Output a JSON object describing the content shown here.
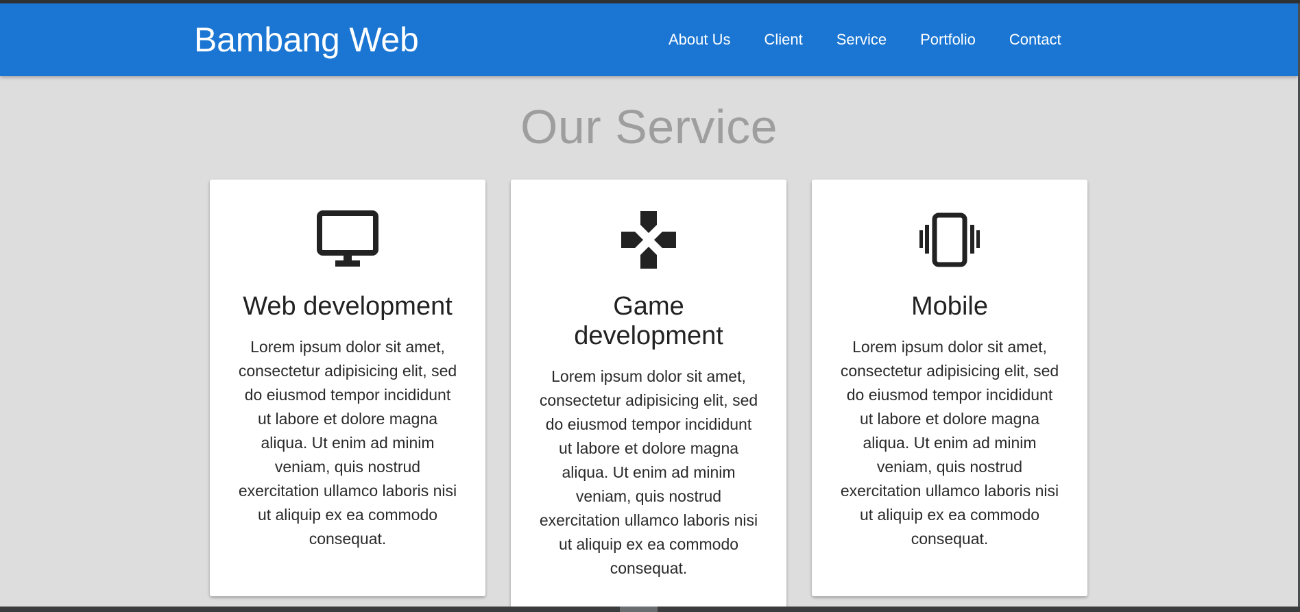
{
  "brand": "Bambang Web",
  "nav": {
    "items": [
      {
        "label": "About Us"
      },
      {
        "label": "Client"
      },
      {
        "label": "Service"
      },
      {
        "label": "Portfolio"
      },
      {
        "label": "Contact"
      }
    ]
  },
  "services": {
    "title": "Our Service",
    "cards": [
      {
        "icon": "desktop-monitor-icon",
        "title": "Web development",
        "text": "Lorem ipsum dolor sit amet, consectetur adipisicing elit, sed do eiusmod tempor incididunt ut labore et dolore magna aliqua. Ut enim ad minim veniam, quis nostrud exercitation ullamco laboris nisi ut aliquip ex ea commodo consequat."
      },
      {
        "icon": "gamepad-dpad-icon",
        "title": "Game development",
        "text": "Lorem ipsum dolor sit amet, consectetur adipisicing elit, sed do eiusmod tempor incididunt ut labore et dolore magna aliqua. Ut enim ad minim veniam, quis nostrud exercitation ullamco laboris nisi ut aliquip ex ea commodo consequat."
      },
      {
        "icon": "vibrating-phone-icon",
        "title": "Mobile",
        "text": "Lorem ipsum dolor sit amet, consectetur adipisicing elit, sed do eiusmod tempor incididunt ut labore et dolore magna aliqua. Ut enim ad minim veniam, quis nostrud exercitation ullamco laboris nisi ut aliquip ex ea commodo consequat."
      }
    ]
  },
  "colors": {
    "navbar": "#1b76d3",
    "background": "#dddddd",
    "section_title": "#9e9e9e",
    "card": "#ffffff",
    "icon": "#222222"
  }
}
